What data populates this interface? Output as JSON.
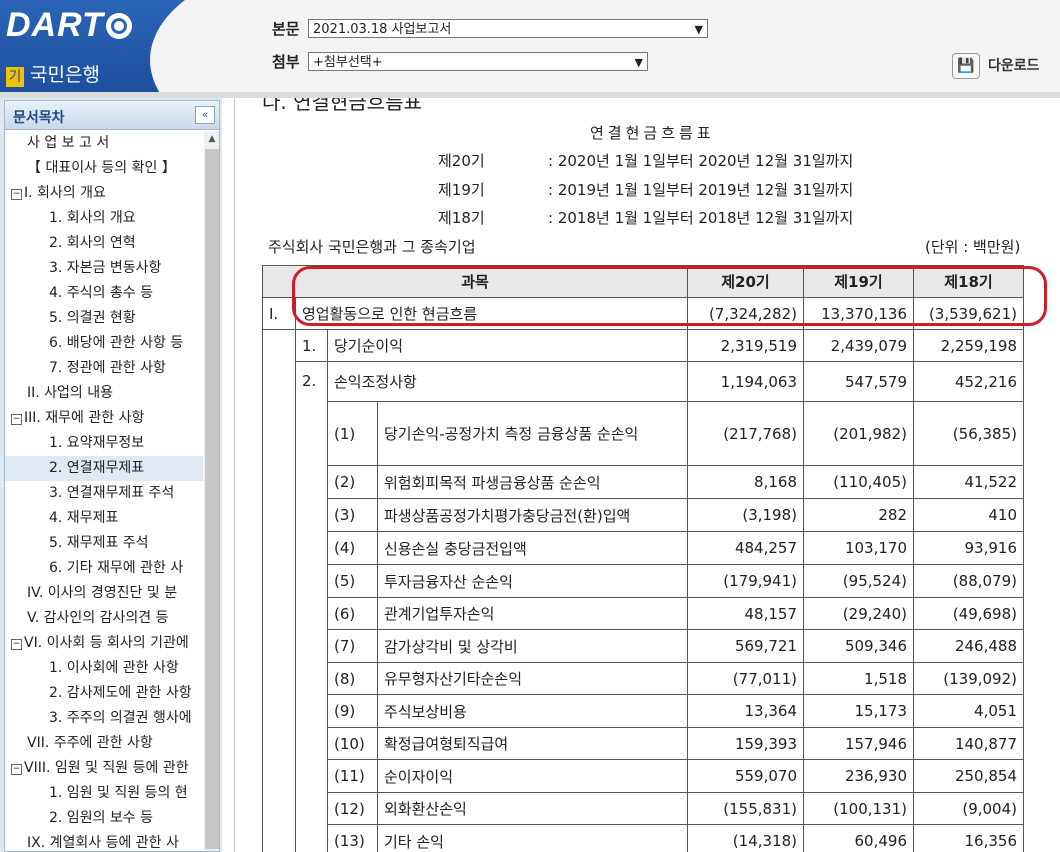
{
  "header": {
    "logo_text": "DART",
    "bank_badge": "기",
    "bank_name": "국민은행",
    "body_label": "본문",
    "body_select_value": "2021.03.18  사업보고서",
    "attach_label": "첨부",
    "attach_select_value": "+첨부선택+",
    "download_label": "다운로드"
  },
  "sidebar": {
    "title": "문서목차",
    "collapse_icon": "«",
    "items": [
      {
        "label": "사 업 보 고 서",
        "indent": 1
      },
      {
        "label": "【 대표이사 등의 확인 】",
        "indent": 1
      },
      {
        "label": "I. 회사의 개요",
        "indent": 0,
        "expander": "−"
      },
      {
        "label": "1. 회사의 개요",
        "indent": 2
      },
      {
        "label": "2. 회사의 연혁",
        "indent": 2
      },
      {
        "label": "3. 자본금 변동사항",
        "indent": 2
      },
      {
        "label": "4. 주식의 총수 등",
        "indent": 2
      },
      {
        "label": "5. 의결권 현황",
        "indent": 2
      },
      {
        "label": "6. 배당에 관한 사항 등",
        "indent": 2
      },
      {
        "label": "7. 정관에 관한 사항",
        "indent": 2
      },
      {
        "label": "II. 사업의 내용",
        "indent": 1
      },
      {
        "label": "III. 재무에 관한 사항",
        "indent": 0,
        "expander": "−"
      },
      {
        "label": "1. 요약재무정보",
        "indent": 2
      },
      {
        "label": "2. 연결재무제표",
        "indent": 2,
        "selected": true
      },
      {
        "label": "3. 연결재무제표 주석",
        "indent": 2
      },
      {
        "label": "4. 재무제표",
        "indent": 2
      },
      {
        "label": "5. 재무제표 주석",
        "indent": 2
      },
      {
        "label": "6. 기타 재무에 관한 사",
        "indent": 2
      },
      {
        "label": "IV. 이사의 경영진단 및 분",
        "indent": 1
      },
      {
        "label": "V. 감사인의 감사의견 등",
        "indent": 1
      },
      {
        "label": "VI. 이사회 등 회사의 기관에",
        "indent": 0,
        "expander": "−"
      },
      {
        "label": "1. 이사회에 관한 사항",
        "indent": 2
      },
      {
        "label": "2. 감사제도에 관한 사항",
        "indent": 2
      },
      {
        "label": "3. 주주의 의결권 행사에",
        "indent": 2
      },
      {
        "label": "VII. 주주에 관한 사항",
        "indent": 1
      },
      {
        "label": "VIII. 임원 및 직원 등에 관한",
        "indent": 0,
        "expander": "−"
      },
      {
        "label": "1. 임원 및 직원 등의 현",
        "indent": 2
      },
      {
        "label": "2. 임원의 보수 등",
        "indent": 2
      },
      {
        "label": "IX. 계열회사 등에 관한 사",
        "indent": 1
      }
    ]
  },
  "content": {
    "section_heading": "다. 연결현금흐름표",
    "report_title": "연결현금흐름표",
    "periods": [
      {
        "term": "제20기",
        "range": ": 2020년 1월 1일부터 2020년 12월 31일까지"
      },
      {
        "term": "제19기",
        "range": ": 2019년 1월 1일부터 2019년 12월 31일까지"
      },
      {
        "term": "제18기",
        "range": ": 2018년 1월 1일부터 2018년 12월 31일까지"
      }
    ],
    "company": "주식회사 국민은행과 그 종속기업",
    "unit": "(단위 : 백만원)",
    "table": {
      "headers": [
        "과목",
        "제20기",
        "제19기",
        "제18기"
      ],
      "top_row": {
        "num": "I.",
        "label": "영업활동으로 인한 현금흐름",
        "values": [
          "(7,324,282)",
          "13,370,136",
          "(3,539,621)"
        ]
      },
      "row1": {
        "num": "1.",
        "label": "당기순이익",
        "values": [
          "2,319,519",
          "2,439,079",
          "2,259,198"
        ]
      },
      "row2": {
        "num": "2.",
        "label": "손익조정사항",
        "values": [
          "1,194,063",
          "547,579",
          "452,216"
        ]
      },
      "sub_rows": [
        {
          "num": "(1)",
          "label": "당기손익-공정가치 측정 금융상품 순손익",
          "values": [
            "(217,768)",
            "(201,982)",
            "(56,385)"
          ]
        },
        {
          "num": "(2)",
          "label": "위험회피목적 파생금융상품 순손익",
          "values": [
            "8,168",
            "(110,405)",
            "41,522"
          ]
        },
        {
          "num": "(3)",
          "label": "파생상품공정가치평가충당금전(환)입액",
          "values": [
            "(3,198)",
            "282",
            "410"
          ]
        },
        {
          "num": "(4)",
          "label": "신용손실 충당금전입액",
          "values": [
            "484,257",
            "103,170",
            "93,916"
          ]
        },
        {
          "num": "(5)",
          "label": "투자금융자산 순손익",
          "values": [
            "(179,941)",
            "(95,524)",
            "(88,079)"
          ]
        },
        {
          "num": "(6)",
          "label": "관계기업투자손익",
          "values": [
            "48,157",
            "(29,240)",
            "(49,698)"
          ]
        },
        {
          "num": "(7)",
          "label": "감가상각비 및 상각비",
          "values": [
            "569,721",
            "509,346",
            "246,488"
          ]
        },
        {
          "num": "(8)",
          "label": "유무형자산기타순손익",
          "values": [
            "(77,011)",
            "1,518",
            "(139,092)"
          ]
        },
        {
          "num": "(9)",
          "label": "주식보상비용",
          "values": [
            "13,364",
            "15,173",
            "4,051"
          ]
        },
        {
          "num": "(10)",
          "label": "확정급여형퇴직급여",
          "values": [
            "159,393",
            "157,946",
            "140,877"
          ]
        },
        {
          "num": "(11)",
          "label": "순이자이익",
          "values": [
            "559,070",
            "236,930",
            "250,854"
          ]
        },
        {
          "num": "(12)",
          "label": "외화환산손익",
          "values": [
            "(155,831)",
            "(100,131)",
            "(9,004)"
          ]
        },
        {
          "num": "(13)",
          "label": "기타 손익",
          "values": [
            "(14,318)",
            "60,496",
            "16,356"
          ]
        }
      ]
    }
  }
}
